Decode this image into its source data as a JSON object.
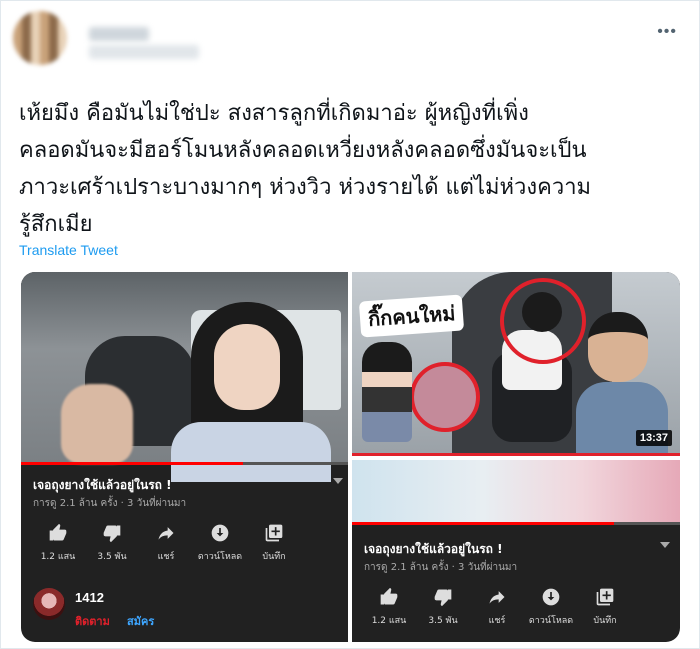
{
  "header": {
    "more_label": "•••"
  },
  "tweet": {
    "text": "เห้ยมึง คือมันไม่ใช่ปะ สงสารลูกที่เกิดมาอ่ะ ผู้หญิงที่เพิ่ง\nคลอดมันจะมีฮอร์โมนหลังคลอดเหวี่ยงหลังคลอดซึ่งมันจะเป็น\nภาวะเศร้าเปราะบางมากๆ ห่วงวิว ห่วงรายได้ แต่ไม่ห่วงความ\nรู้สึกเมีย",
    "translate_label": "Translate Tweet"
  },
  "video_left": {
    "title": "เจอถุงยางใช้แล้วอยู่ในรถ !",
    "meta": "การดู 2.1 ล้าน ครั้ง · 3 วันที่ผ่านมา",
    "actions": [
      {
        "icon": "thumbs-up-icon",
        "label": "1.2 แสน"
      },
      {
        "icon": "thumbs-down-icon",
        "label": "3.5 พัน"
      },
      {
        "icon": "share-icon",
        "label": "แชร์"
      },
      {
        "icon": "download-icon",
        "label": "ดาวน์โหลด"
      },
      {
        "icon": "save-icon",
        "label": "บันทึก"
      }
    ],
    "channel_name": "1412",
    "subscribe_label": "ติดตาม",
    "member_label": "สมัคร"
  },
  "video_right_top": {
    "overlay_text": "กิ๊กคนใหม่",
    "duration": "13:37"
  },
  "video_right_bottom": {
    "title": "เจอถุงยางใช้แล้วอยู่ในรถ !",
    "meta": "การดู 2.1 ล้าน ครั้ง · 3 วันที่ผ่านมา",
    "actions": [
      {
        "icon": "thumbs-up-icon",
        "label": "1.2 แสน"
      },
      {
        "icon": "thumbs-down-icon",
        "label": "3.5 พัน"
      },
      {
        "icon": "share-icon",
        "label": "แชร์"
      },
      {
        "icon": "download-icon",
        "label": "ดาวน์โหลด"
      },
      {
        "icon": "save-icon",
        "label": "บันทึก"
      }
    ]
  },
  "colors": {
    "link": "#1d9bf0",
    "youtube_dark": "#212121",
    "red": "#e0212b"
  }
}
